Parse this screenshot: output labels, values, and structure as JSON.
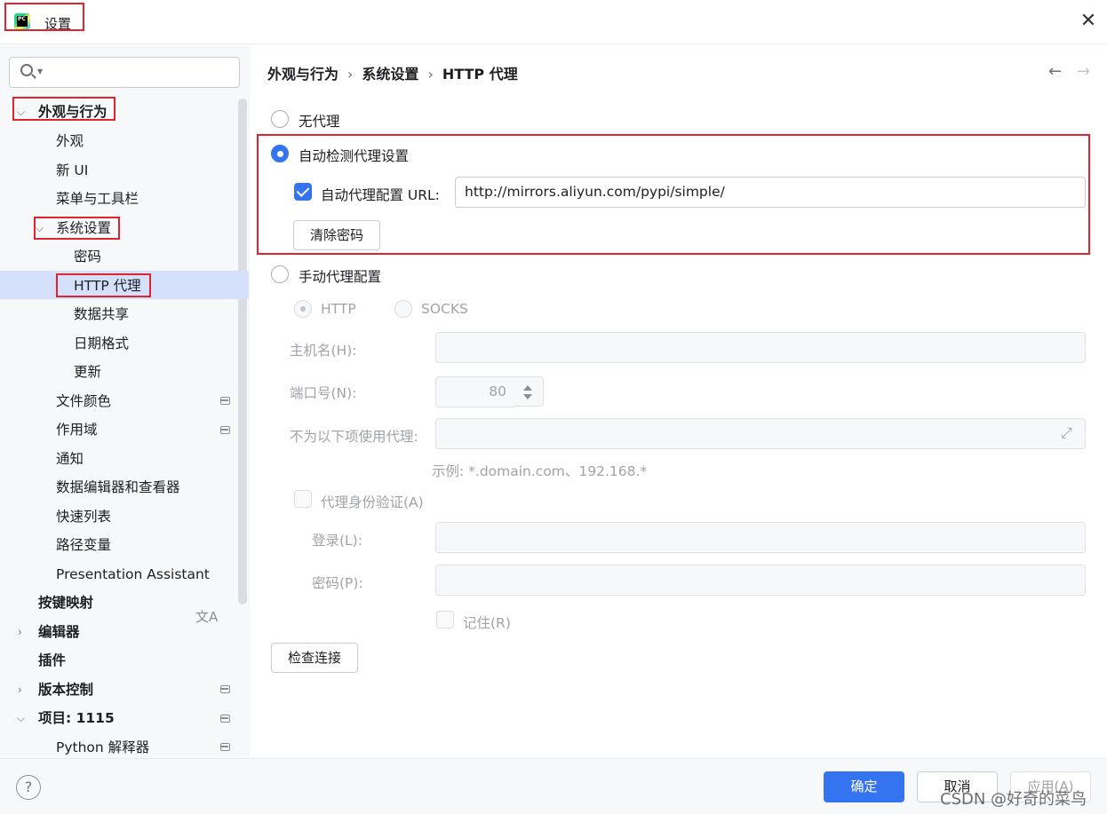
{
  "window": {
    "title": "设置",
    "app_icon_label": "PC"
  },
  "sidebar": {
    "search_placeholder": "",
    "items": [
      {
        "label": "外观与行为"
      },
      {
        "label": "外观"
      },
      {
        "label": "新 UI"
      },
      {
        "label": "菜单与工具栏"
      },
      {
        "label": "系统设置"
      },
      {
        "label": "密码"
      },
      {
        "label": "HTTP 代理"
      },
      {
        "label": "数据共享"
      },
      {
        "label": "日期格式"
      },
      {
        "label": "更新"
      },
      {
        "label": "文件颜色"
      },
      {
        "label": "作用域"
      },
      {
        "label": "通知"
      },
      {
        "label": "数据编辑器和查看器"
      },
      {
        "label": "快速列表"
      },
      {
        "label": "路径变量"
      },
      {
        "label": "Presentation Assistant"
      },
      {
        "label": "按键映射"
      },
      {
        "label": "编辑器"
      },
      {
        "label": "插件"
      },
      {
        "label": "版本控制"
      },
      {
        "label": "项目: 1115"
      },
      {
        "label": "Python 解释器"
      }
    ]
  },
  "breadcrumb": {
    "level1": "外观与行为",
    "level2": "系统设置",
    "level3": "HTTP 代理"
  },
  "proxy": {
    "no_proxy": "无代理",
    "auto_detect": "自动检测代理设置",
    "auto_config_url_label": "自动代理配置 URL:",
    "auto_config_url_value": "http://mirrors.aliyun.com/pypi/simple/",
    "clear_password": "清除密码",
    "manual": "手动代理配置",
    "http": "HTTP",
    "socks": "SOCKS",
    "host_label": "主机名(H):",
    "port_label": "端口号(N):",
    "port_value": "80",
    "no_proxy_for_label": "不为以下项使用代理:",
    "example": "示例: *.domain.com、192.168.*",
    "auth_label": "代理身份验证(A)",
    "login_label": "登录(L):",
    "password_label": "密码(P):",
    "remember_label": "记住(R)",
    "check_connection": "检查连接"
  },
  "footer": {
    "help": "?",
    "ok": "确定",
    "cancel": "取消",
    "apply": "应用(A)",
    "watermark": "CSDN @好奇的菜鸟"
  },
  "colors": {
    "accent": "#3574f0",
    "selection": "#d5e1fc",
    "highlight_box": "#e0232f"
  }
}
